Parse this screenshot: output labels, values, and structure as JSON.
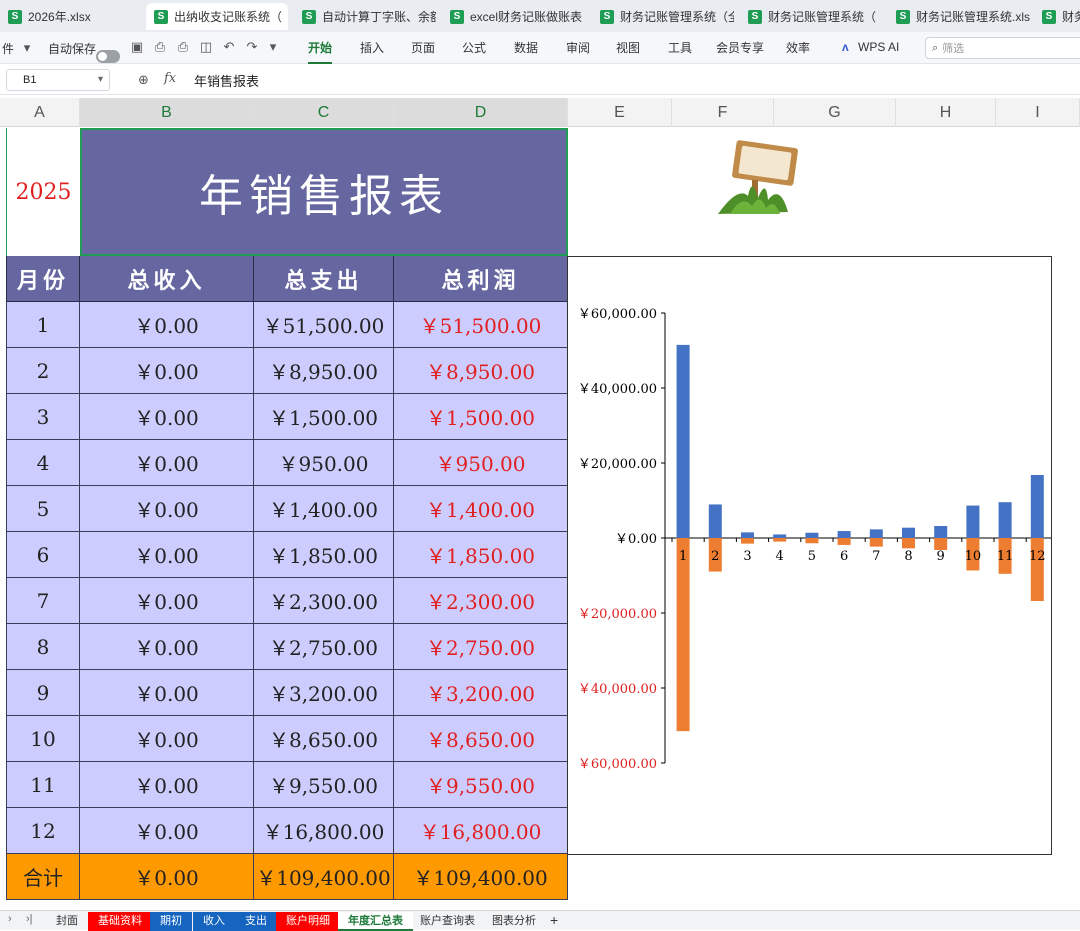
{
  "tabs": [
    {
      "label": "2026年.xlsx"
    },
    {
      "label": "出纳收支记账系统（"
    },
    {
      "label": "自动计算丁字账、余额"
    },
    {
      "label": "excel财务记账做账表"
    },
    {
      "label": "财务记账管理系统（全"
    },
    {
      "label": "财务记账管理系统（"
    },
    {
      "label": "财务记账管理系统.xls"
    },
    {
      "label": "财务记"
    }
  ],
  "toolbar": {
    "file_partial": "件",
    "autosave": "自动保存",
    "menus": [
      "开始",
      "插入",
      "页面",
      "公式",
      "数据",
      "审阅",
      "视图",
      "工具",
      "会员专享",
      "效率"
    ],
    "wps_ai": "WPS AI",
    "search_placeholder": "筛选"
  },
  "formula_bar": {
    "cell_ref": "B1",
    "fx": "fx",
    "content": "年销售报表"
  },
  "columns": [
    "A",
    "B",
    "C",
    "D",
    "E",
    "F",
    "G",
    "H",
    "I"
  ],
  "sheet": {
    "year": "2025",
    "title": "年销售报表",
    "headers": [
      "月份",
      "总收入",
      "总支出",
      "总利润"
    ],
    "rows": [
      {
        "month": "1",
        "income": "￥0.00",
        "expense": "￥51,500.00",
        "profit": "￥51,500.00"
      },
      {
        "month": "2",
        "income": "￥0.00",
        "expense": "￥8,950.00",
        "profit": "￥8,950.00"
      },
      {
        "month": "3",
        "income": "￥0.00",
        "expense": "￥1,500.00",
        "profit": "￥1,500.00"
      },
      {
        "month": "4",
        "income": "￥0.00",
        "expense": "￥950.00",
        "profit": "￥950.00"
      },
      {
        "month": "5",
        "income": "￥0.00",
        "expense": "￥1,400.00",
        "profit": "￥1,400.00"
      },
      {
        "month": "6",
        "income": "￥0.00",
        "expense": "￥1,850.00",
        "profit": "￥1,850.00"
      },
      {
        "month": "7",
        "income": "￥0.00",
        "expense": "￥2,300.00",
        "profit": "￥2,300.00"
      },
      {
        "month": "8",
        "income": "￥0.00",
        "expense": "￥2,750.00",
        "profit": "￥2,750.00"
      },
      {
        "month": "9",
        "income": "￥0.00",
        "expense": "￥3,200.00",
        "profit": "￥3,200.00"
      },
      {
        "month": "10",
        "income": "￥0.00",
        "expense": "￥8,650.00",
        "profit": "￥8,650.00"
      },
      {
        "month": "11",
        "income": "￥0.00",
        "expense": "￥9,550.00",
        "profit": "￥9,550.00"
      },
      {
        "month": "12",
        "income": "￥0.00",
        "expense": "￥16,800.00",
        "profit": "￥16,800.00"
      }
    ],
    "total": {
      "label": "合计",
      "income": "￥0.00",
      "expense": "￥109,400.00",
      "profit": "￥109,400.00"
    }
  },
  "chart_data": {
    "type": "bar",
    "categories": [
      "1",
      "2",
      "3",
      "4",
      "5",
      "6",
      "7",
      "8",
      "9",
      "10",
      "11",
      "12"
    ],
    "series": [
      {
        "values": [
          51500,
          8950,
          1500,
          950,
          1400,
          1850,
          2300,
          2750,
          3200,
          8650,
          9550,
          16800
        ],
        "color": "#4472c4"
      },
      {
        "values": [
          -51500,
          -8950,
          -1500,
          -950,
          -1400,
          -1850,
          -2300,
          -2750,
          -3200,
          -8650,
          -9550,
          -16800
        ],
        "color": "#ed7d31"
      }
    ],
    "ylim": [
      -60000,
      60000
    ],
    "yticks": [
      "￥60,000.00",
      "￥40,000.00",
      "￥20,000.00",
      "￥0.00",
      "￥20,000.00",
      "￥40,000.00",
      "￥60,000.00"
    ],
    "ytick_values": [
      60000,
      40000,
      20000,
      0,
      -20000,
      -40000,
      -60000
    ],
    "negative_label_color": "#e02020",
    "grid": false,
    "legend": "none"
  },
  "sheet_tabs": [
    {
      "label": "封面",
      "style": "plain"
    },
    {
      "label": "基础资料",
      "style": "red"
    },
    {
      "label": "期初",
      "style": "blue"
    },
    {
      "label": "收入",
      "style": "blue"
    },
    {
      "label": "支出",
      "style": "blue"
    },
    {
      "label": "账户明细",
      "style": "red"
    },
    {
      "label": "年度汇总表",
      "style": "active"
    },
    {
      "label": "账户查询表",
      "style": "plain"
    },
    {
      "label": "图表分析",
      "style": "plain"
    }
  ],
  "colors": {
    "header_bg": "#6667a0",
    "body_bg": "#ccccff",
    "total_bg": "#ff9900",
    "profit_text": "#e02020"
  }
}
